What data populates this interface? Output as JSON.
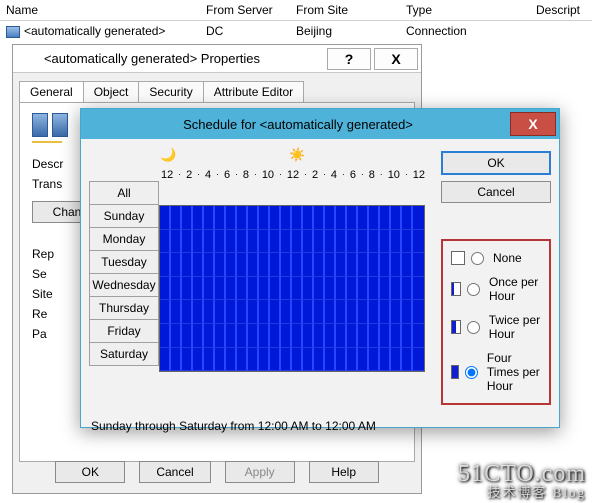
{
  "columns": {
    "name": "Name",
    "fromServer": "From Server",
    "fromSite": "From Site",
    "type": "Type",
    "description": "Descript"
  },
  "row": {
    "name": "<automatically generated>",
    "fromServer": "DC",
    "fromSite": "Beijing",
    "type": "Connection"
  },
  "propsWindow": {
    "title": "<automatically generated> Properties",
    "help_glyph": "?",
    "close_glyph": "X",
    "tabs": {
      "general": "General",
      "object": "Object",
      "security": "Security",
      "attributeEditor": "Attribute Editor"
    },
    "labels": {
      "descr": "Descr",
      "trans": "Trans",
      "chan": "Chan",
      "rep": "Rep",
      "se": "Se",
      "site": "Site",
      "re": "Re",
      "pa": "Pa"
    },
    "buttons": {
      "ok": "OK",
      "cancel": "Cancel",
      "apply": "Apply",
      "help": "Help"
    }
  },
  "schedDialog": {
    "title": "Schedule for <automatically generated>",
    "close_glyph": "X",
    "hours": [
      "12",
      "·",
      "2",
      "·",
      "4",
      "·",
      "6",
      "·",
      "8",
      "·",
      "10",
      "·",
      "12",
      "·",
      "2",
      "·",
      "4",
      "·",
      "6",
      "·",
      "8",
      "·",
      "10",
      "·",
      "12"
    ],
    "days": {
      "all": "All",
      "list": [
        "Sunday",
        "Monday",
        "Tuesday",
        "Wednesday",
        "Thursday",
        "Friday",
        "Saturday"
      ]
    },
    "buttons": {
      "ok": "OK",
      "cancel": "Cancel"
    },
    "legend": {
      "none": "None",
      "once": "Once per Hour",
      "twice": "Twice per Hour",
      "four": "Four Times per Hour"
    },
    "selectedLegend": "four",
    "status": "Sunday through Saturday from 12:00 AM to 12:00 AM"
  },
  "watermark": {
    "main": "51CTO.com",
    "sub": "技术博客   Blog"
  }
}
